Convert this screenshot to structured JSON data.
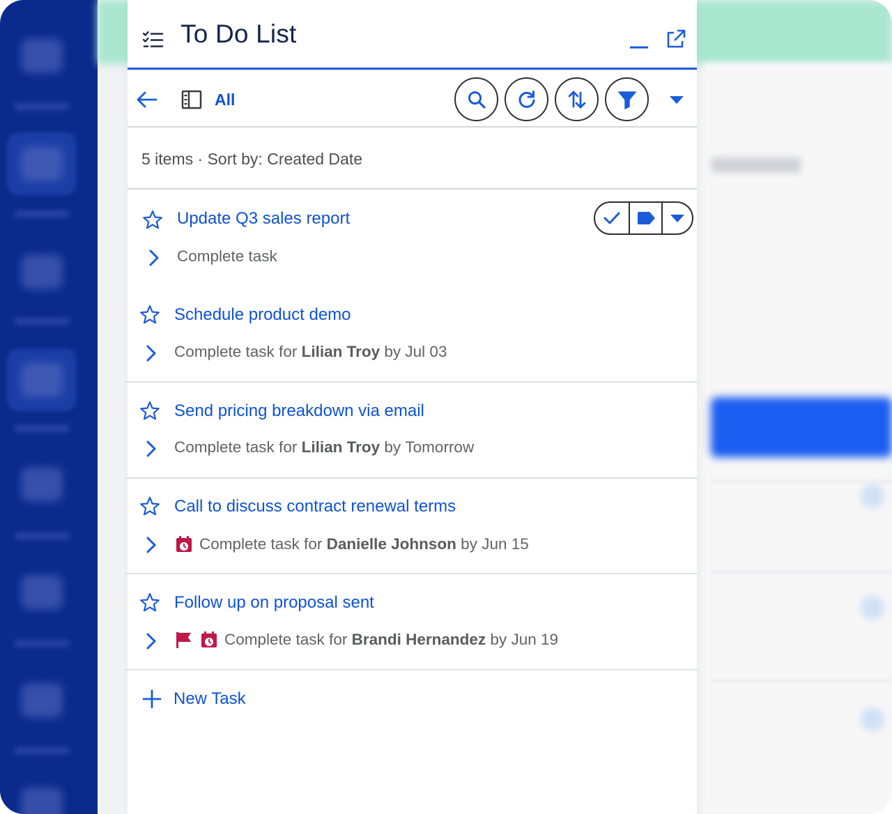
{
  "panel": {
    "title": "To Do List",
    "view_filter": "All",
    "summary": "5 items · Sort by: Created Date",
    "new_task_label": "New Task"
  },
  "icons": {
    "header": [
      "checklist-icon",
      "minimize-icon",
      "pop-out-icon"
    ],
    "toolbar": [
      "back-arrow-icon",
      "list-view-icon",
      "search-icon",
      "refresh-icon",
      "sort-icon",
      "filter-icon",
      "caret-down-icon"
    ],
    "row_actions": [
      "check-icon",
      "tag-icon",
      "caret-down-icon"
    ]
  },
  "colors": {
    "accent": "#0f52d6",
    "header_rule": "#1a5cd8",
    "alert_icon": "#c0174a",
    "sidebar_bg": "#0a2a8c"
  },
  "tasks": [
    {
      "name": "Update Q3 sales report",
      "prefix": "Complete task",
      "contact": "",
      "by": "",
      "due": "",
      "flags": []
    },
    {
      "name": "Schedule product demo",
      "prefix": "Complete task for",
      "contact": "Lilian Troy",
      "by": "by",
      "due": "Jul 03",
      "flags": []
    },
    {
      "name": "Send pricing breakdown via email",
      "prefix": "Complete task for",
      "contact": "Lilian Troy",
      "by": "by",
      "due": "Tomorrow",
      "flags": []
    },
    {
      "name": "Call to discuss contract renewal terms",
      "prefix": "Complete task for",
      "contact": "Danielle Johnson",
      "by": "by",
      "due": "Jun 15",
      "flags": [
        "overdue-calendar-icon"
      ]
    },
    {
      "name": "Follow up on proposal sent",
      "prefix": "Complete task for",
      "contact": "Brandi Hernandez",
      "by": "by",
      "due": "Jun 19",
      "flags": [
        "priority-flag-icon",
        "overdue-calendar-icon"
      ]
    }
  ]
}
